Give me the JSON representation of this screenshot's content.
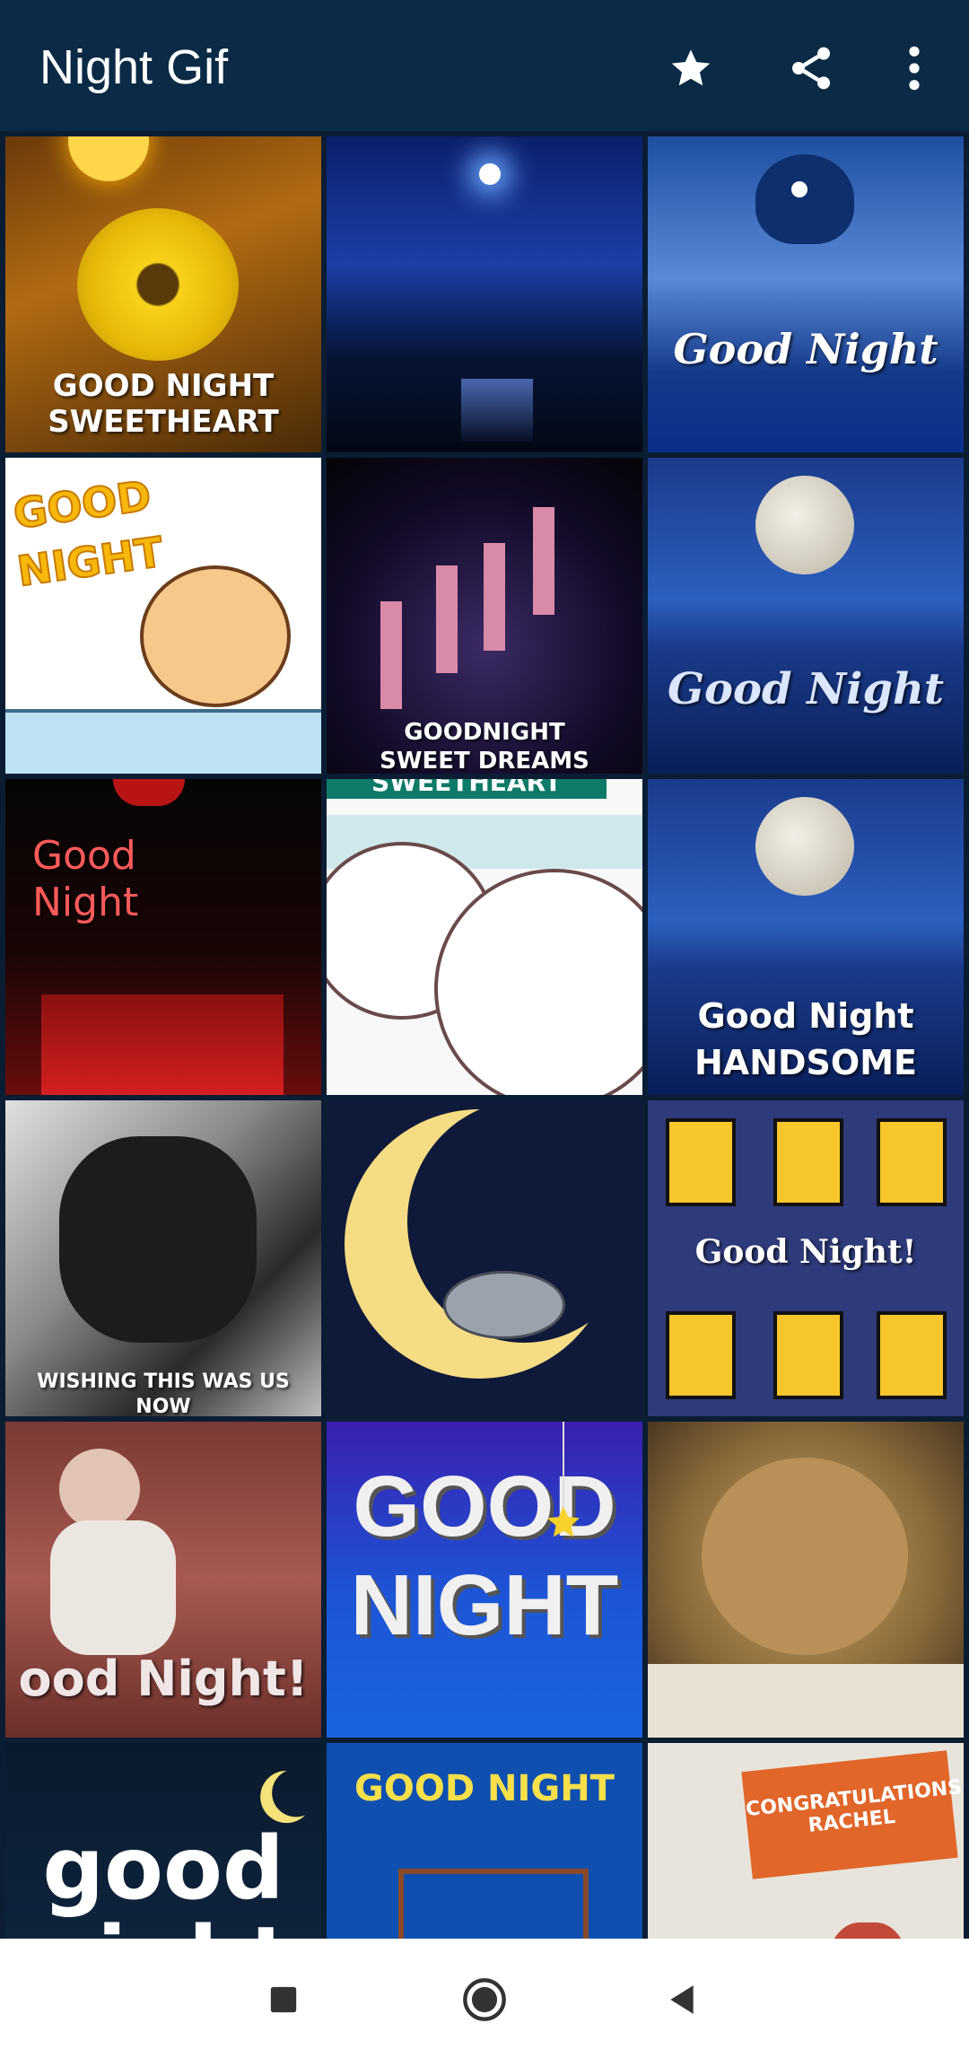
{
  "app": {
    "title": "Night Gif"
  },
  "toolbar": {
    "favorite_icon": "star-icon",
    "share_icon": "share-icon",
    "more_icon": "more-vert-icon"
  },
  "gifs": [
    {
      "caption": "GOOD NIGHT\nSWEETHEART"
    },
    {
      "caption": ""
    },
    {
      "caption": "Good Night"
    },
    {
      "caption": "GOOD NIGHT"
    },
    {
      "caption": "GOODNIGHT\nSWEET DREAMS"
    },
    {
      "caption": "Good Night"
    },
    {
      "caption": "Good\nNight"
    },
    {
      "caption": "SWEETHEART"
    },
    {
      "caption": "Good Night\nHANDSOME"
    },
    {
      "caption": "WISHING THIS WAS US\nNOW"
    },
    {
      "caption": ""
    },
    {
      "caption": "Good Night!"
    },
    {
      "caption": "ood Night!"
    },
    {
      "caption": "GOOD\nNIGHT"
    },
    {
      "caption": ""
    },
    {
      "caption": "good\nnight"
    },
    {
      "caption": "GOOD NIGHT"
    },
    {
      "caption": "CONGRATULATIONS RACHEL"
    }
  ],
  "nav": {
    "recents_icon": "square-icon",
    "home_icon": "circle-icon",
    "back_icon": "back-triangle-icon"
  },
  "colors": {
    "appbar": "#0a2a45",
    "grid_bg": "#0b1d33",
    "navbar": "#ffffff"
  }
}
